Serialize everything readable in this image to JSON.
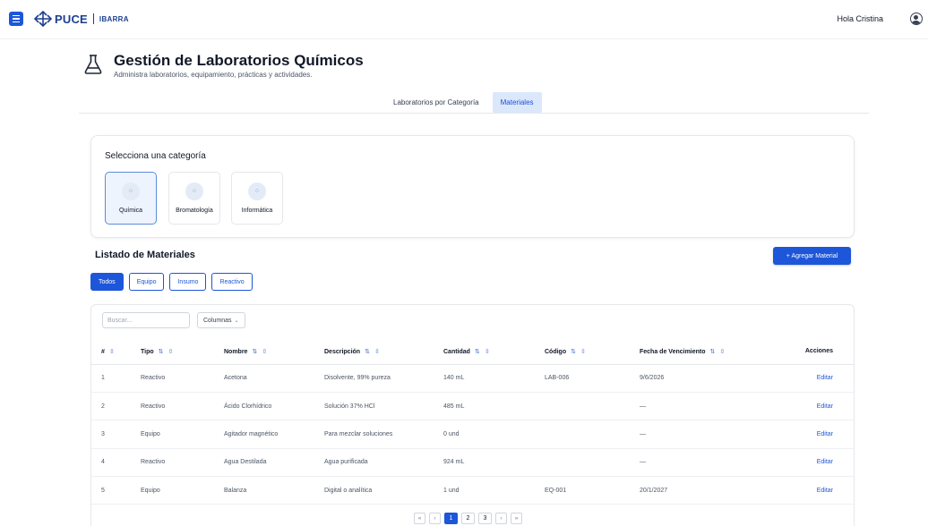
{
  "topbar": {
    "brand": "PUCE",
    "campus": "IBARRA",
    "greeting": "Hola Cristina"
  },
  "header": {
    "title": "Gestión de Laboratorios Químicos",
    "subtitle": "Administra laboratorios, equipamiento, prácticas y actividades."
  },
  "tabs": [
    {
      "label": "Laboratorios por Categoría",
      "active": false
    },
    {
      "label": "Materiales",
      "active": true
    }
  ],
  "categories": {
    "title": "Selecciona una categoría",
    "items": [
      {
        "label": "Química",
        "active": true
      },
      {
        "label": "Bromatología",
        "active": false
      },
      {
        "label": "Informática",
        "active": false
      }
    ]
  },
  "list": {
    "title": "Listado de Materiales",
    "add_label": "+ Agregar Material",
    "filters": [
      "Todos",
      "Equipo",
      "Insumo",
      "Reactivo"
    ],
    "active_filter": "Todos",
    "search_placeholder": "Buscar...",
    "columns_label": "Columnas"
  },
  "table": {
    "headers": [
      "#",
      "Tipo",
      "Nombre",
      "Descripción",
      "Cantidad",
      "Código",
      "Fecha de Vencimiento",
      "Acciones"
    ],
    "rows": [
      [
        "1",
        "Reactivo",
        "Acetona",
        "Disolvente, 99% pureza",
        "140 mL",
        "LAB-006",
        "9/6/2026",
        "Editar"
      ],
      [
        "2",
        "Reactivo",
        "Ácido Clorhídrico",
        "Solución 37% HCl",
        "485 mL",
        "",
        "—",
        "Editar"
      ],
      [
        "3",
        "Equipo",
        "Agitador magnético",
        "Para mezclar soluciones",
        "0 und",
        "",
        "—",
        "Editar"
      ],
      [
        "4",
        "Reactivo",
        "Agua Destilada",
        "Agua purificada",
        "924 mL",
        "",
        "—",
        "Editar"
      ],
      [
        "5",
        "Equipo",
        "Balanza",
        "Digital o analítica",
        "1 und",
        "EQ-001",
        "20/1/2027",
        "Editar"
      ]
    ]
  },
  "pagination": {
    "first": "«",
    "prev": "‹",
    "pages": [
      "1",
      "2",
      "3"
    ],
    "current": "1",
    "next": "›",
    "last": "»"
  }
}
